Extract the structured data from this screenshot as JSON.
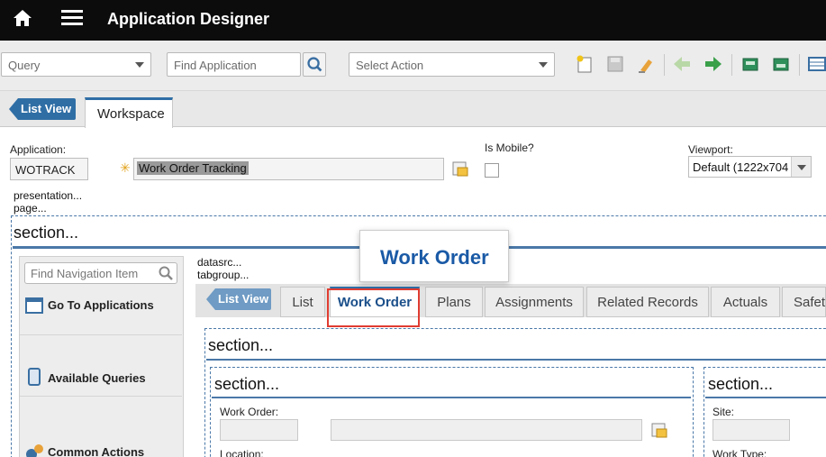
{
  "header": {
    "title": "Application Designer"
  },
  "toolbar": {
    "query_value": "Query",
    "find_placeholder": "Find Application",
    "select_action_placeholder": "Select Action"
  },
  "tabs": {
    "list_view": "List View",
    "workspace": "Workspace"
  },
  "application": {
    "app_label": "Application:",
    "app_code": "WOTRACK",
    "app_description": "Work Order Tracking",
    "mobile_label": "Is Mobile?",
    "mobile_checked": false,
    "viewport_label": "Viewport:",
    "viewport_value": "Default (1222x704"
  },
  "designer": {
    "presentation": "presentation...",
    "page": "page...",
    "section": "section...",
    "datasrc": "datasrc...",
    "tabgroup": "tabgroup...",
    "nav_search_placeholder": "Find Navigation Item",
    "nav_items": [
      "Go To Applications",
      "Available Queries",
      "Common Actions"
    ],
    "inner_tabs": [
      "List",
      "Work Order",
      "Plans",
      "Assignments",
      "Related Records",
      "Actuals",
      "Safety"
    ],
    "selected_tab": "Work Order",
    "callout": "Work Order",
    "fields": {
      "work_order": "Work Order:",
      "location": "Location:",
      "site": "Site:",
      "work_type": "Work Type:"
    }
  },
  "colors": {
    "top_bar": "#0c0c0c",
    "accent_blue": "#2f6ea5",
    "highlight_red": "#e03c31",
    "callout_text": "#1a5aa6"
  },
  "icons": [
    "home-icon",
    "menu-icon",
    "search-icon",
    "new-record-icon",
    "save-icon",
    "clear-icon",
    "previous-icon",
    "next-icon",
    "import-icon",
    "export-icon",
    "grid-icon",
    "lookup-icon",
    "applications-icon",
    "queries-icon",
    "actions-icon"
  ]
}
